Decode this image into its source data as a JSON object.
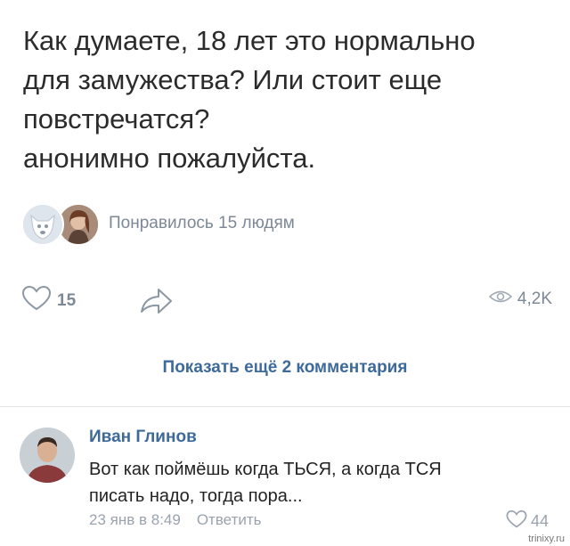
{
  "post": {
    "lines": [
      "Как думаете, 18 лет это нормально",
      "для замужества? Или стоит еще",
      "повстречатся?",
      "анонимно пожалуйста."
    ]
  },
  "likes_summary": {
    "text": "Понравилось 15 людям",
    "avatars": [
      "dog-avatar",
      "girl-avatar"
    ]
  },
  "actions": {
    "like_icon": "heart-icon",
    "like_count": "15",
    "share_icon": "share-arrow-icon",
    "views_icon": "eye-icon",
    "views_count": "4,2K"
  },
  "show_more": "Показать ещё 2 комментария",
  "comment": {
    "author": "Иван Глинов",
    "lines": [
      "Вот как поймёшь когда ТЬСЯ, а когда ТСЯ",
      "писать надо, тогда пора..."
    ],
    "timestamp": "23 янв в 8:49",
    "reply_label": "Ответить",
    "like_icon": "heart-icon",
    "like_count": "44"
  },
  "watermark": "trinixy.ru",
  "colors": {
    "link_blue": "#3d6a9a",
    "meta_gray": "#9aa3ad",
    "icon_gray": "#7d8896"
  }
}
